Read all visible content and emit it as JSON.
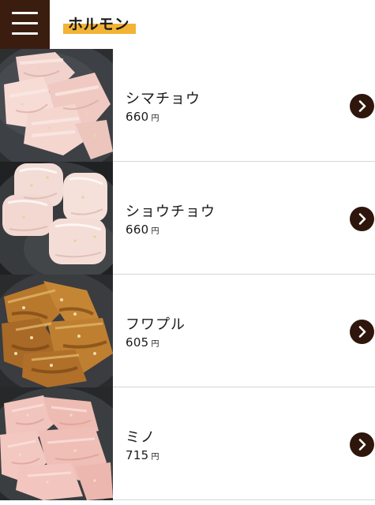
{
  "header": {
    "menu_icon": "hamburger-menu-icon",
    "category_title": "ホルモン"
  },
  "colors": {
    "menu_button_bg": "#3b1d10",
    "title_highlight": "#f2b336",
    "arrow_button_bg": "#2f160c",
    "divider": "#d6d6d6"
  },
  "items": [
    {
      "name": "シマチョウ",
      "price": "660",
      "unit": "円",
      "arrow_icon": "chevron-right-icon"
    },
    {
      "name": "ショウチョウ",
      "price": "660",
      "unit": "円",
      "arrow_icon": "chevron-right-icon"
    },
    {
      "name": "フワプル",
      "price": "605",
      "unit": "円",
      "arrow_icon": "chevron-right-icon"
    },
    {
      "name": "ミノ",
      "price": "715",
      "unit": "円",
      "arrow_icon": "chevron-right-icon"
    }
  ]
}
